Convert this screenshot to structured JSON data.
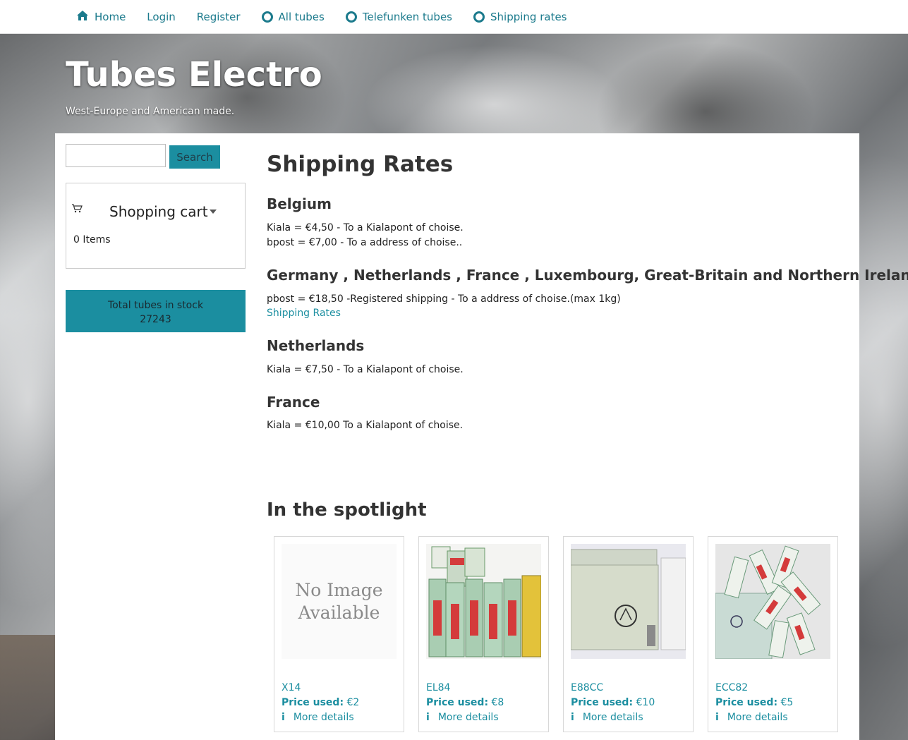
{
  "nav": {
    "items": [
      {
        "label": "Home",
        "icon": "home-icon"
      },
      {
        "label": "Login"
      },
      {
        "label": "Register"
      },
      {
        "label": "All tubes",
        "icon": "circle-icon"
      },
      {
        "label": "Telefunken tubes",
        "icon": "circle-icon"
      },
      {
        "label": "Shipping rates",
        "icon": "circle-icon"
      }
    ]
  },
  "header": {
    "title": "Tubes Electro",
    "tagline": "West-Europe and American made."
  },
  "sidebar": {
    "search_button": "Search",
    "search_value": "",
    "cart_title": "Shopping cart",
    "cart_items": "0 Items",
    "stock_label": "Total tubes in stock",
    "stock_count": "27243"
  },
  "main": {
    "title": "Shipping Rates",
    "sections": [
      {
        "heading": "Belgium",
        "lines": [
          "Kiala = €4,50 - To a Kialapont of choise.",
          "bpost = €7,00 - To a address of choise.."
        ]
      },
      {
        "heading": "Germany , Netherlands , France , Luxembourg, Great-Britain and Northern Ireland",
        "lines": [
          "pbost = €18,50 -Registered shipping - To a address of choise.(max 1kg)"
        ],
        "link": "Shipping Rates"
      },
      {
        "heading": "Netherlands",
        "lines": [
          "Kiala = €7,50 - To a Kialapont of choise."
        ]
      },
      {
        "heading": "France",
        "lines": [
          "Kiala = €10,00 To a Kialapont of choise."
        ]
      }
    ],
    "spotlight_title": "In the spotlight",
    "products": [
      {
        "name": "X14",
        "price_label": "Price used:",
        "price": "€2",
        "more": "More details",
        "image_text": "No Image Available"
      },
      {
        "name": "EL84",
        "price_label": "Price used:",
        "price": "€8",
        "more": "More details"
      },
      {
        "name": "E88CC",
        "price_label": "Price used:",
        "price": "€10",
        "more": "More details"
      },
      {
        "name": "ECC82",
        "price_label": "Price used:",
        "price": "€5",
        "more": "More details"
      }
    ]
  },
  "colors": {
    "accent": "#1b8ea0",
    "link": "#1b7a8c"
  }
}
